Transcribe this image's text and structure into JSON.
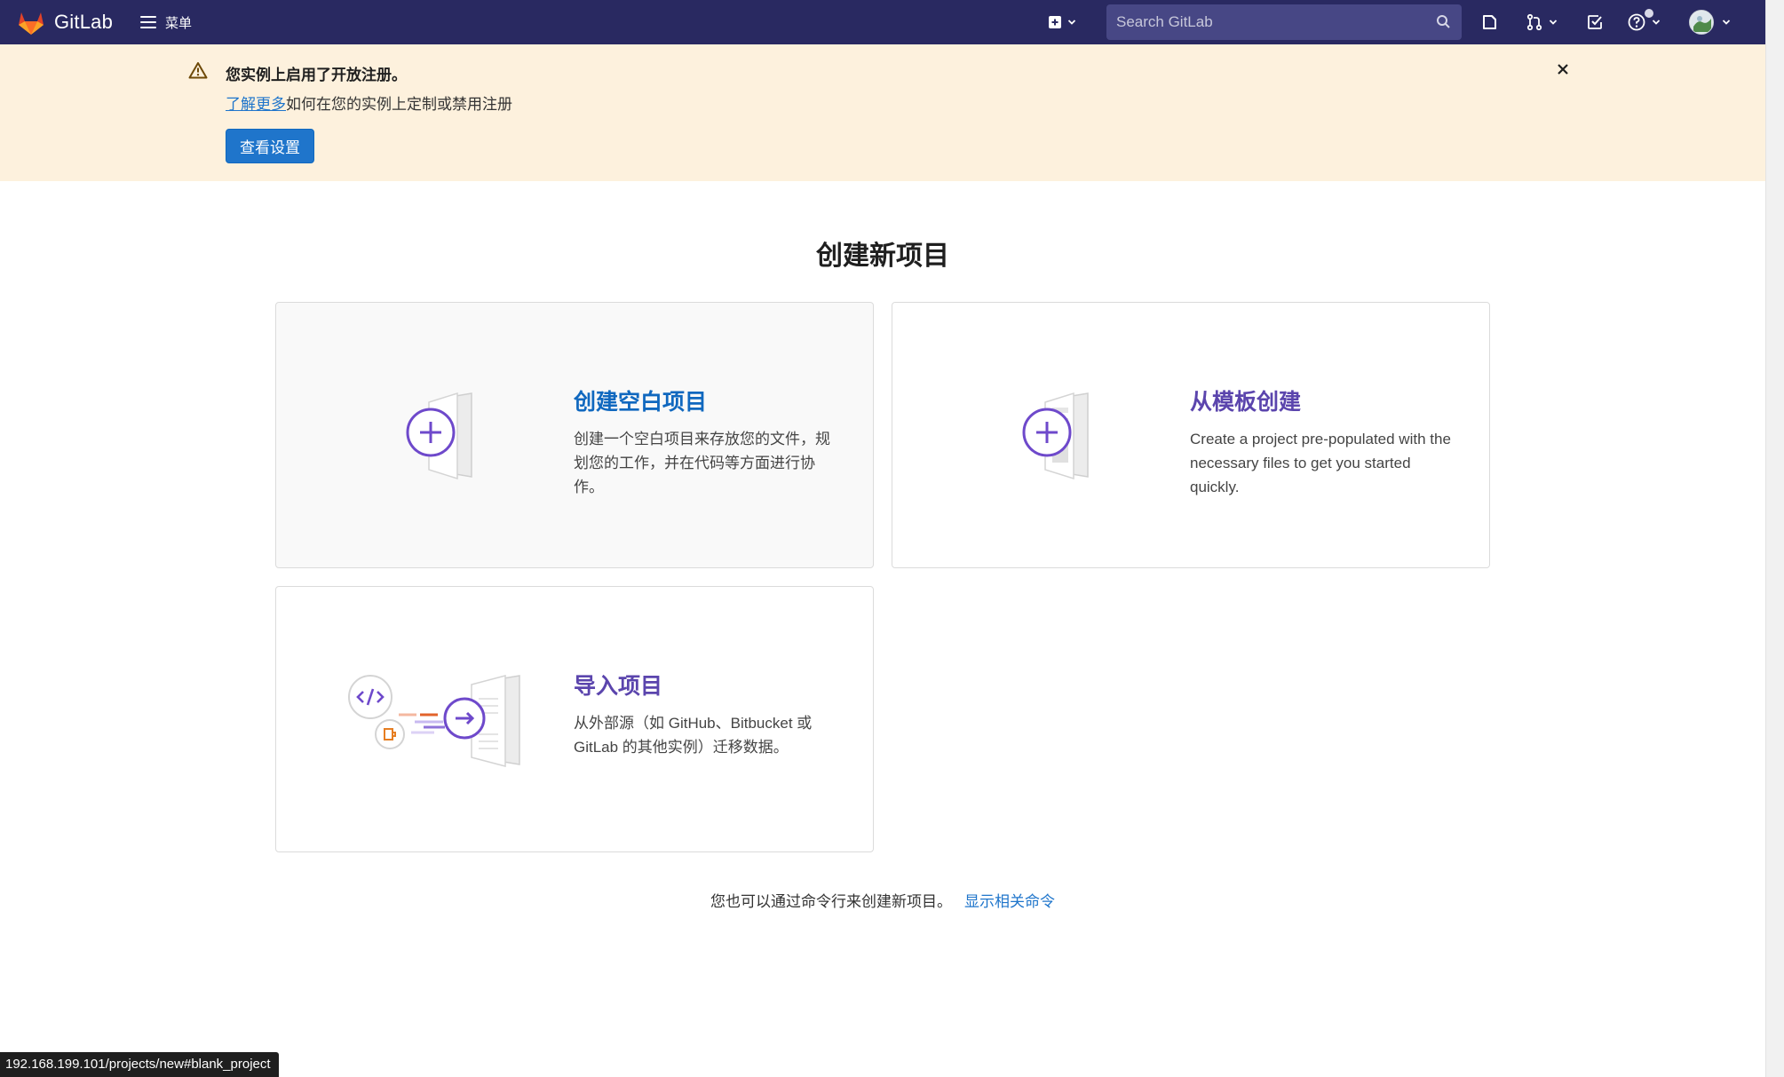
{
  "navbar": {
    "brand": "GitLab",
    "menu_label": "菜单",
    "search_placeholder": "Search GitLab"
  },
  "alert": {
    "title": "您实例上启用了开放注册。",
    "link": "了解更多",
    "body": "如何在您的实例上定制或禁用注册",
    "button": "查看设置"
  },
  "page": {
    "title": "创建新项目"
  },
  "cards": {
    "blank": {
      "title": "创建空白项目",
      "desc": "创建一个空白项目来存放您的文件，规划您的工作，并在代码等方面进行协作。"
    },
    "template": {
      "title": "从模板创建",
      "desc": "Create a project pre-populated with the necessary files to get you started quickly."
    },
    "import": {
      "title": "导入项目",
      "desc": "从外部源（如 GitHub、Bitbucket 或 GitLab 的其他实例）迁移数据。"
    }
  },
  "cli": {
    "text": "您也可以通过命令行来创建新项目。",
    "link": "显示相关命令"
  },
  "status_bar": {
    "url": "192.168.199.101/projects/new#blank_project"
  },
  "colors": {
    "navbar_bg": "#292961",
    "alert_bg": "#fdf1dd",
    "primary_blue": "#1f75cb",
    "purple": "#5b45ad"
  },
  "icons": [
    "gitlab-logo",
    "hamburger-icon",
    "plus-square-icon",
    "chevron-down-icon",
    "search-icon",
    "issues-icon",
    "merge-request-icon",
    "todo-icon",
    "help-icon",
    "avatar",
    "warning-icon",
    "close-icon"
  ]
}
